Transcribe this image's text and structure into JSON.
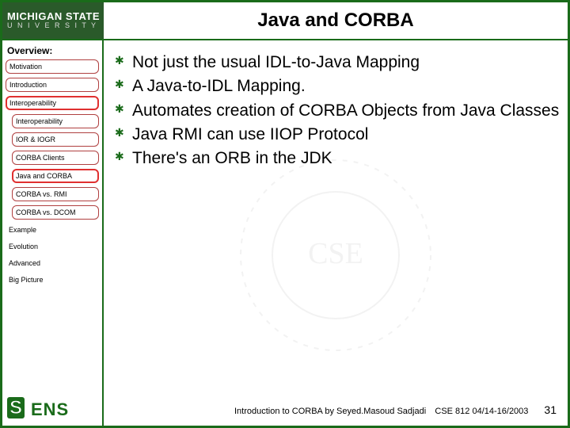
{
  "header": {
    "logo_line1": "MICHIGAN STATE",
    "logo_line2": "U N I V E R S I T Y",
    "title": "Java and CORBA"
  },
  "sidebar": {
    "title": "Overview:",
    "items": [
      {
        "label": "Motivation",
        "sub": false,
        "box": true,
        "active": false
      },
      {
        "label": "Introduction",
        "sub": false,
        "box": true,
        "active": false
      },
      {
        "label": "Interoperability",
        "sub": false,
        "box": true,
        "active": true
      },
      {
        "label": "Interoperability",
        "sub": true,
        "box": true,
        "active": false
      },
      {
        "label": "IOR & IOGR",
        "sub": true,
        "box": true,
        "active": false
      },
      {
        "label": "CORBA Clients",
        "sub": true,
        "box": true,
        "active": false
      },
      {
        "label": "Java and CORBA",
        "sub": true,
        "box": true,
        "active": true
      },
      {
        "label": "CORBA vs. RMI",
        "sub": true,
        "box": true,
        "active": false
      },
      {
        "label": "CORBA vs. DCOM",
        "sub": true,
        "box": true,
        "active": false
      },
      {
        "label": "Example",
        "sub": false,
        "box": false,
        "active": false
      },
      {
        "label": "Evolution",
        "sub": false,
        "box": false,
        "active": false
      },
      {
        "label": "Advanced",
        "sub": false,
        "box": false,
        "active": false
      },
      {
        "label": "Big Picture",
        "sub": false,
        "box": false,
        "active": false
      }
    ]
  },
  "bullets": [
    "Not just the usual IDL-to-Java Mapping",
    "A Java-to-IDL Mapping.",
    "Automates creation of CORBA Objects from Java Classes",
    "Java RMI can use IIOP Protocol",
    "There's an ORB in the JDK"
  ],
  "footer": {
    "title": "Introduction to CORBA by Seyed.Masoud Sadjadi",
    "course": "CSE 812   04/14-16/2003",
    "page": "31"
  },
  "sens": {
    "s": "S",
    "rest": "ENS"
  }
}
